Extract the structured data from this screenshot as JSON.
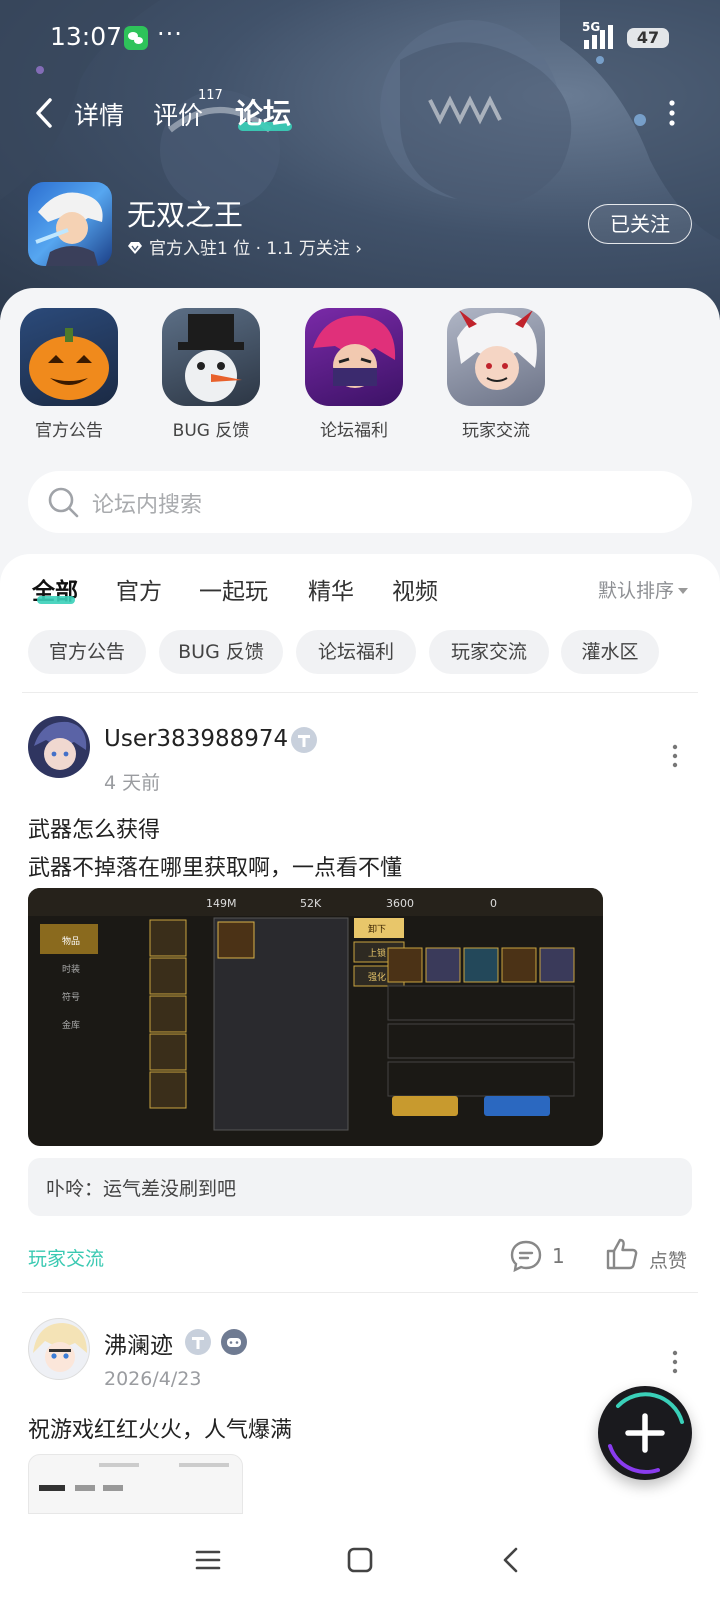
{
  "status_bar": {
    "time": "13:07",
    "network": "5G",
    "battery": "47"
  },
  "nav": {
    "tabs": [
      {
        "label": "详情"
      },
      {
        "label": "评价",
        "count": "117"
      },
      {
        "label": "论坛"
      }
    ]
  },
  "app": {
    "name": "无双之王",
    "meta": "官方入驻1 位 · 1.1 万关注",
    "follow_label": "已关注"
  },
  "categories": [
    {
      "label": "官方公告"
    },
    {
      "label": "BUG 反馈"
    },
    {
      "label": "论坛福利"
    },
    {
      "label": "玩家交流"
    }
  ],
  "search": {
    "placeholder": "论坛内搜索"
  },
  "feed_tabs": [
    {
      "label": "全部",
      "active": true
    },
    {
      "label": "官方"
    },
    {
      "label": "一起玩"
    },
    {
      "label": "精华"
    },
    {
      "label": "视频"
    }
  ],
  "sort_label": "默认排序",
  "chips": [
    {
      "label": "官方公告"
    },
    {
      "label": "BUG 反馈"
    },
    {
      "label": "论坛福利"
    },
    {
      "label": "玩家交流"
    },
    {
      "label": "灌水区"
    }
  ],
  "posts": [
    {
      "username": "User383988974",
      "time": "4 天前",
      "title": "武器怎么获得",
      "body": "武器不掉落在哪里获取啊，一点看不懂",
      "reply": "卟呤：运气差没刷到吧",
      "topic": "玩家交流",
      "comment_count": "1",
      "like_label": "点赞",
      "image_stats": [
        "149M",
        "52K",
        "3600",
        "0"
      ],
      "image_menu": [
        "物品",
        "时装",
        "符号",
        "金库"
      ],
      "image_actions": [
        "卸下",
        "上锁",
        "强化"
      ]
    },
    {
      "username": "沸澜迹",
      "time": "2026/4/23",
      "title": "祝游戏红红火火，人气爆满"
    }
  ],
  "colors": {
    "accent": "#3ad0b9",
    "topic": "#3ac9b2"
  }
}
